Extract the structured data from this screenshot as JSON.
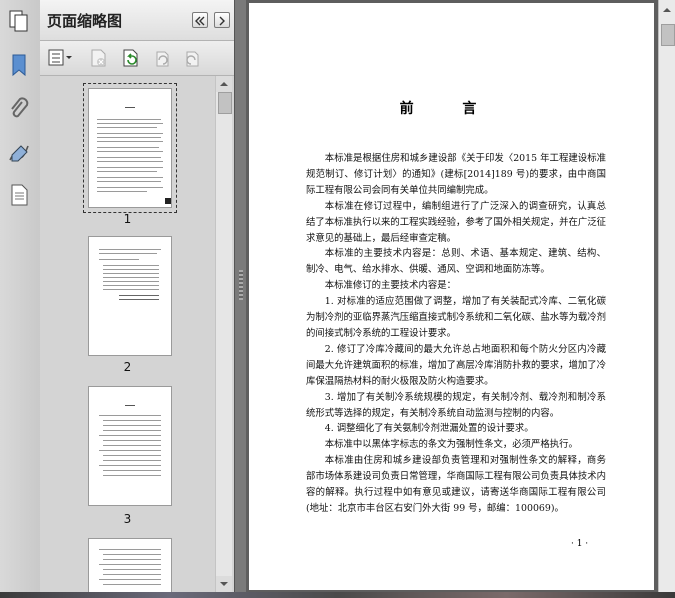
{
  "panel": {
    "title": "页面缩略图",
    "page_numbers": [
      "1",
      "2",
      "3"
    ]
  },
  "document": {
    "heading": "前 言",
    "paragraphs": [
      "本标准是根据住房和城乡建设部《关于印发〈2015 年工程建设标准规范制订、修订计划〉的通知》(建标[2014]189 号)的要求，由中商国际工程有限公司会同有关单位共同编制完成。",
      "本标准在修订过程中，编制组进行了广泛深入的调查研究，认真总结了本标准执行以来的工程实践经验，参考了国外相关规定，并在广泛征求意见的基础上，最后经审查定稿。",
      "本标准的主要技术内容是：总则、术语、基本规定、建筑、结构、制冷、电气、给水排水、供暖、通风、空调和地面防冻等。",
      "本标准修订的主要技术内容是：",
      "1. 对标准的适应范围做了调整，增加了有关装配式冷库、二氧化碳为制冷剂的亚临界蒸汽压缩直接式制冷系统和二氧化碳、盐水等为载冷剂的间接式制冷系统的工程设计要求。",
      "2. 修订了冷库冷藏间的最大允许总占地面积和每个防火分区内冷藏间最大允许建筑面积的标准，增加了高层冷库消防扑救的要求，增加了冷库保温隔热材料的耐火极限及防火构造要求。",
      "3. 增加了有关制冷系统规模的规定，有关制冷剂、载冷剂和制冷系统形式等选择的规定，有关制冷系统自动监测与控制的内容。",
      "4. 调整细化了有关氨制冷剂泄漏处置的设计要求。",
      "本标准中以黑体字标志的条文为强制性条文，必须严格执行。",
      "本标准由住房和城乡建设部负责管理和对强制性条文的解释，商务部市场体系建设司负责日常管理，华商国际工程有限公司负责具体技术内容的解释。执行过程中如有意见或建议，请寄送华商国际工程有限公司(地址：北京市丰台区右安门外大街 99 号，邮编：100069)。"
    ],
    "folio": "· 1 ·"
  }
}
